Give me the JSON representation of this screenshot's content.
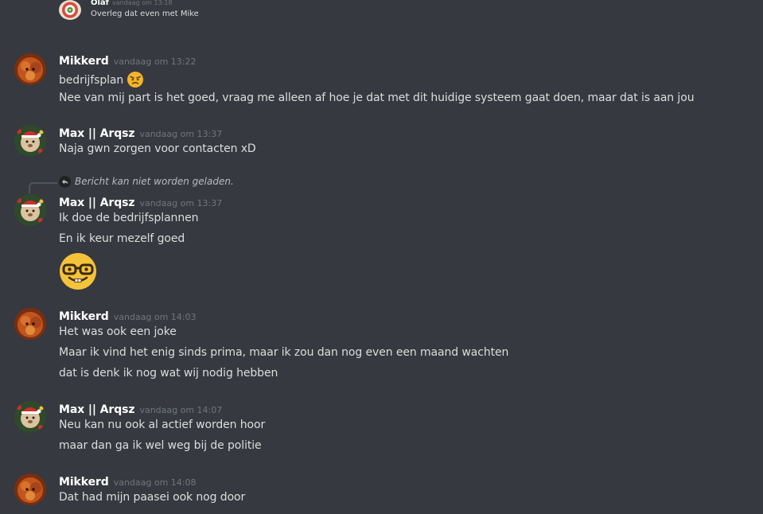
{
  "previous_message": {
    "username": "Olaf",
    "timestamp": "vandaag om 13:18",
    "text": "Overleg dat even met Mike"
  },
  "reply_reference": {
    "text": "Bericht kan niet worden geladen."
  },
  "messages": [
    {
      "username": "Mikkerd",
      "timestamp": "vandaag om 13:22",
      "lines": [
        "bedrijfsplan",
        "Nee van mij part is het goed, vraag me alleen af hoe je dat met dit huidige systeem gaat doen, maar dat is aan jou"
      ],
      "inline_emoji": "angry-face-emoji"
    },
    {
      "username": "Max || Arqsz",
      "timestamp": "vandaag om 13:37",
      "lines": [
        "Naja gwn zorgen voor contacten xD"
      ]
    },
    {
      "username": "Max || Arqsz",
      "timestamp": "vandaag om 13:37",
      "lines": [
        "Ik doe de bedrijfsplannen",
        "En ik keur mezelf goed"
      ],
      "big_emoji": "nerd-face-emoji"
    },
    {
      "username": "Mikkerd",
      "timestamp": "vandaag om 14:03",
      "lines": [
        "Het was ook een joke",
        "Maar ik vind het enig sinds prima, maar ik zou dan nog even een maand wachten",
        "dat is denk ik nog wat wij nodig hebben"
      ]
    },
    {
      "username": "Max || Arqsz",
      "timestamp": "vandaag om 14:07",
      "lines": [
        "Neu kan nu ook al actief worden hoor",
        "maar dan ga ik wel weg bij de politie"
      ]
    },
    {
      "username": "Mikkerd",
      "timestamp": "vandaag om 14:08",
      "lines": [
        "Dat had mijn paasei ook nog door"
      ]
    }
  ],
  "colors": {
    "background": "#36393f",
    "username": "#ffffff",
    "timestamp": "#72767d",
    "message_text": "#dcddde"
  }
}
